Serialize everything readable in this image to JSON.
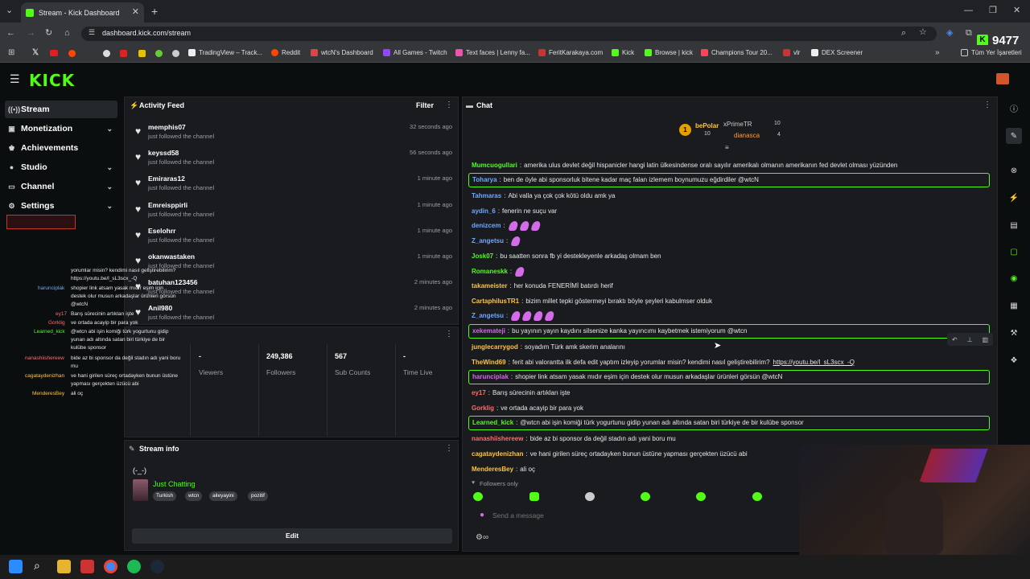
{
  "browser": {
    "tab_title": "Stream - Kick Dashboard",
    "url": "dashboard.kick.com/stream",
    "counter": "9477",
    "bookmarks": [
      "TradingView – Track...",
      "Reddit",
      "wtcN's Dashboard",
      "All Games - Twitch",
      "Text faces | Lenny fa...",
      "FeritKarakaya.com",
      "Kick",
      "Browse | kick",
      "Champions Tour 20...",
      "vlr",
      "DEX Screener"
    ],
    "all_bookmarks": "Tüm Yer İşaretleri"
  },
  "brand": {
    "logo": "KICK",
    "accent": "#53fc18"
  },
  "sidebar": {
    "items": [
      {
        "label": "Stream",
        "icon": "broadcast-icon",
        "expand": false
      },
      {
        "label": "Monetization",
        "icon": "dollar-icon",
        "expand": true
      },
      {
        "label": "Achievements",
        "icon": "trophy-icon",
        "expand": false
      },
      {
        "label": "Studio",
        "icon": "studio-icon",
        "expand": true
      },
      {
        "label": "Channel",
        "icon": "channel-icon",
        "expand": true
      },
      {
        "label": "Settings",
        "icon": "gear-icon",
        "expand": true
      }
    ]
  },
  "activity": {
    "title": "Activity Feed",
    "filter": "Filter",
    "items": [
      {
        "name": "memphis07",
        "sub": "just followed the channel",
        "time": "32 seconds ago"
      },
      {
        "name": "keyssd58",
        "sub": "just followed the channel",
        "time": "56 seconds ago"
      },
      {
        "name": "Emiraras12",
        "sub": "just followed the channel",
        "time": "1 minute ago"
      },
      {
        "name": "Emreisppirli",
        "sub": "just followed the channel",
        "time": "1 minute ago"
      },
      {
        "name": "Eselohrr",
        "sub": "just followed the channel",
        "time": "1 minute ago"
      },
      {
        "name": "okanwastaken",
        "sub": "just followed the channel",
        "time": "1 minute ago"
      },
      {
        "name": "batuhan123456",
        "sub": "just followed the channel",
        "time": "2 minutes ago"
      },
      {
        "name": "Anil980",
        "sub": "just followed the channel",
        "time": "2 minutes ago"
      }
    ]
  },
  "stats": {
    "viewers": {
      "value": "-",
      "label": "Viewers"
    },
    "followers": {
      "value": "249,386",
      "label": "Followers"
    },
    "subs": {
      "value": "567",
      "label": "Sub Counts"
    },
    "time_live": {
      "value": "-",
      "label": "Time Live"
    }
  },
  "stream_info": {
    "title": "Stream info",
    "face": "(-_-)",
    "category": "Just Chatting",
    "tags": [
      "Turkish",
      "wtcn",
      "aileyayini",
      "pozitif"
    ],
    "edit": "Edit"
  },
  "chat": {
    "title": "Chat",
    "leaders": [
      {
        "rank": "1",
        "name": "bePolar",
        "count": "10"
      },
      {
        "name": "xPrimeTR",
        "count": "10"
      },
      {
        "name": "dianasca",
        "count": "4"
      }
    ],
    "messages": [
      {
        "user": "Mumcuogullari",
        "color": "#53fc18",
        "text": "amerika ulus devlet değil hispanicler hangi latin ülkesindense oralı sayılır amerikalı olmanın amerikanın fed devlet olması yüzünden",
        "hl": false,
        "emotes": 0
      },
      {
        "user": "Toharya",
        "color": "#6fa8ff",
        "text": "ben de öyle abi sponsorluk bitene kadar maç falan izlemem boynumuzu eğdirdiler @wtcN",
        "hl": true,
        "emotes": 0
      },
      {
        "user": "Tahmaras",
        "color": "#6fa8ff",
        "text": "Abi valla ya çok çok kötü oldu amk ya",
        "hl": false,
        "emotes": 0
      },
      {
        "user": "aydin_6",
        "color": "#6fa8ff",
        "text": "fenerin ne suçu var",
        "hl": false,
        "emotes": 0
      },
      {
        "user": "denizcem",
        "color": "#6fa8ff",
        "text": "",
        "hl": false,
        "emotes": 3
      },
      {
        "user": "Z_angetsu",
        "color": "#6fa8ff",
        "text": "",
        "hl": false,
        "emotes": 1
      },
      {
        "user": "Josk07",
        "color": "#53fc18",
        "text": "bu saatten sonra fb yi destekleyenle arkadaş olmam ben",
        "hl": false,
        "emotes": 0
      },
      {
        "user": "Romaneskk",
        "color": "#53fc18",
        "text": "",
        "hl": false,
        "emotes": 1
      },
      {
        "user": "takameister",
        "color": "#ffc43d",
        "text": "her konuda FENERİMİ batırdı herif",
        "hl": false,
        "emotes": 0
      },
      {
        "user": "CartaphilusTR1",
        "color": "#ffc43d",
        "text": "bizim millet tepki göstermeyi bıraktı böyle şeyleri kabulmser olduk",
        "hl": false,
        "emotes": 0
      },
      {
        "user": "Z_angetsu",
        "color": "#6fa8ff",
        "text": "",
        "hl": false,
        "emotes": 4
      },
      {
        "user": "xekemateji",
        "color": "#d46be8",
        "text": "bu yayının yayın kaydını silsenize kanka yayıncımı kaybetmek istemiyorum @wtcn",
        "hl": true,
        "emotes": 0
      },
      {
        "user": "junglecarrygod",
        "color": "#ffc43d",
        "text": "soyadım Türk amk skerim analarını",
        "hl": false,
        "emotes": 0
      },
      {
        "user": "TheWind69",
        "color": "#ffc43d",
        "text": "ferit abi valorantta ilk defa edit yaptım izleyip yorumlar misin? kendimi nasıl geliştirebilirim?",
        "link": "https://youtu.be/l_sL3scx_-Q",
        "hl": false,
        "emotes": 0
      },
      {
        "user": "harunciplak",
        "color": "#d46be8",
        "text": "shopier link atsam yasak mıdır eşim için destek olur musun arkadaşlar ürünleri görsün @wtcN",
        "hl": true,
        "emotes": 0
      },
      {
        "user": "ey17",
        "color": "#ff6b6b",
        "text": "Barış sürecinin artıkları işte",
        "hl": false,
        "emotes": 0
      },
      {
        "user": "Gorklig",
        "color": "#ff6b6b",
        "text": "ve ortada acayip bir para yok",
        "hl": false,
        "emotes": 0
      },
      {
        "user": "Learned_kick",
        "color": "#53fc18",
        "text": "@wtcn abi işin komiği türk yogurtunu gidip yunan adı altında satan biri türkiye de bir kulübe sponsor",
        "hl": true,
        "emotes": 0
      },
      {
        "user": "nanashiishereew",
        "color": "#ff6b6b",
        "text": "bide az bi sponsor da değil stadın adı yani boru mu",
        "hl": false,
        "emotes": 0
      },
      {
        "user": "cagataydenizhan",
        "color": "#ffc43d",
        "text": "ve hani girilen süreç ortadayken bunun üstüne yapması gerçekten üzücü abi",
        "hl": false,
        "emotes": 0
      },
      {
        "user": "MenderesBey",
        "color": "#ffc43d",
        "text": "ali oç",
        "hl": false,
        "emotes": 0
      }
    ],
    "followers_only": "Followers only",
    "placeholder": "Send a message"
  },
  "overlay": [
    {
      "user": "",
      "text": "yorumlar misin? kendimi nasıl geliştirebilirim?"
    },
    {
      "user": "",
      "text": "https://youtu.be/l_sL3scx_-Q"
    },
    {
      "user": "harunciplak",
      "text": "shopier link atsam yasak mıdır eşim için"
    },
    {
      "user": "",
      "text": "destek olur musun arkadaşlar ürünleri görsün"
    },
    {
      "user": "",
      "text": "@wtcN"
    },
    {
      "user": "ey17",
      "text": "Barış sürecinin artıkları işte"
    },
    {
      "user": "Gorklig",
      "text": "ve ortada acayip bir para yok"
    },
    {
      "user": "Learned_kick",
      "text": "@wtcn abi işin komiği türk yogurtunu gidip"
    },
    {
      "user": "",
      "text": "yunan adı altında satan biri türkiye de bir"
    },
    {
      "user": "",
      "text": "kulübe sponsor"
    },
    {
      "user": "nanashiishereew",
      "text": "bide az bi sponsor da değil stadın adı yani boru"
    },
    {
      "user": "",
      "text": "mu"
    },
    {
      "user": "cagataydenizhan",
      "text": "ve hani girilen süreç ortadayken bunun üstüne"
    },
    {
      "user": "",
      "text": "yapması gerçekten üzücü abi"
    },
    {
      "user": "MenderesBey",
      "text": "ali oç"
    }
  ]
}
